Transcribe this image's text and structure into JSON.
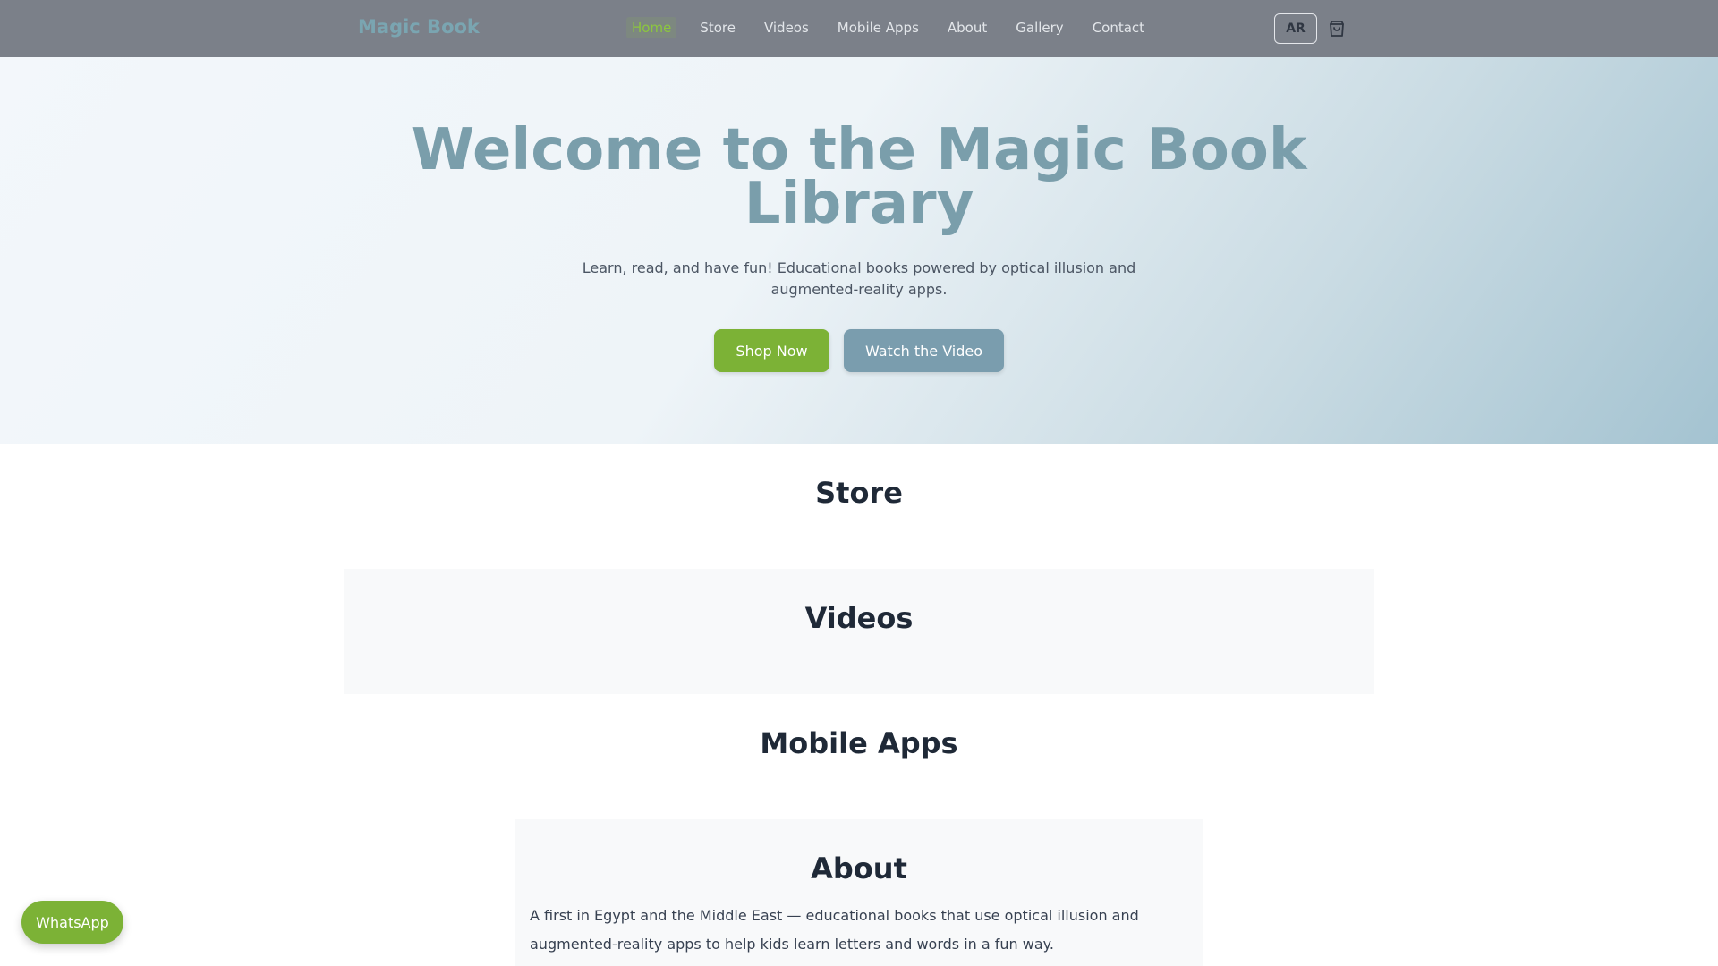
{
  "header": {
    "brand": "Magic Book",
    "nav": [
      "Home",
      "Store",
      "Videos",
      "Mobile Apps",
      "About",
      "Gallery",
      "Contact"
    ],
    "active_nav": "Home",
    "lang_label": "AR",
    "cart_icon": "shopping-bag-icon"
  },
  "hero": {
    "title": "Welcome to the Magic Book Library",
    "subtitle": "Learn, read, and have fun! Educational books powered by optical illusion and augmented-reality apps.",
    "primary_button": "Shop Now",
    "secondary_button": "Watch the Video"
  },
  "sections": {
    "store": "Store",
    "videos": "Videos",
    "mobile_apps": "Mobile Apps",
    "about": "About",
    "about_text": "A first in Egypt and the Middle East — educational books that use optical illusion and augmented-reality apps to help kids learn letters and words in a fun way."
  },
  "floating": {
    "whatsapp_label": "WhatsApp"
  },
  "colors": {
    "accent_green": "#7cb236",
    "accent_blue": "#7a9dae",
    "topbar": "#7b8089"
  }
}
